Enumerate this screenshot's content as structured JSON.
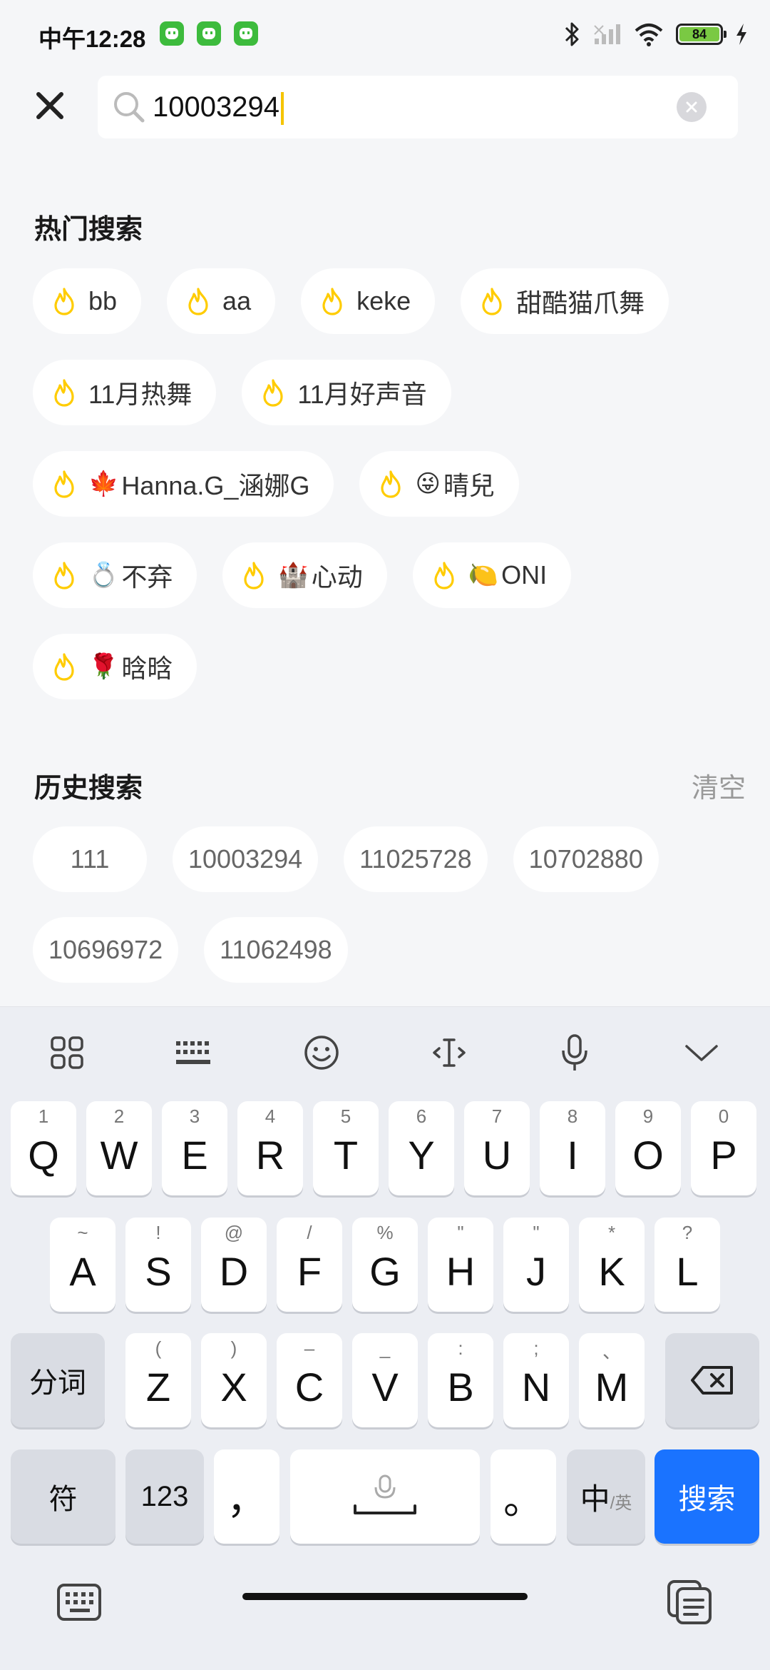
{
  "status_bar": {
    "time": "中午12:28",
    "app_icons": [
      "app-notification-icon",
      "app-notification-icon",
      "app-notification-icon"
    ],
    "battery_level": "84"
  },
  "search": {
    "query": "10003294"
  },
  "hot": {
    "title": "热门搜索",
    "items": [
      {
        "emoji": "",
        "label": "bb"
      },
      {
        "emoji": "",
        "label": "aa"
      },
      {
        "emoji": "",
        "label": "keke"
      },
      {
        "emoji": "",
        "label": "甜酷猫爪舞"
      },
      {
        "emoji": "",
        "label": "11月热舞"
      },
      {
        "emoji": "",
        "label": "11月好声音"
      },
      {
        "emoji": "🍁",
        "label": "Hanna.G_涵娜G"
      },
      {
        "emoji": "😜",
        "label": " 晴兒"
      },
      {
        "emoji": "💍",
        "label": "不弃"
      },
      {
        "emoji": "🏰",
        "label": "心动"
      },
      {
        "emoji": "🍋",
        "label": "ONI"
      },
      {
        "emoji": "🌹",
        "label": "晗晗"
      }
    ]
  },
  "history": {
    "title": "历史搜索",
    "clear_label": "清空",
    "items": [
      "111",
      "10003294",
      "11025728",
      "10702880",
      "10696972",
      "11062498"
    ]
  },
  "keyboard": {
    "toolbar_icons": [
      "apps-grid-icon",
      "keyboard-layout-icon",
      "emoji-icon",
      "cursor-icon",
      "microphone-icon",
      "collapse-icon"
    ],
    "row1": [
      {
        "k": "Q",
        "h": "1"
      },
      {
        "k": "W",
        "h": "2"
      },
      {
        "k": "E",
        "h": "3"
      },
      {
        "k": "R",
        "h": "4"
      },
      {
        "k": "T",
        "h": "5"
      },
      {
        "k": "Y",
        "h": "6"
      },
      {
        "k": "U",
        "h": "7"
      },
      {
        "k": "I",
        "h": "8"
      },
      {
        "k": "O",
        "h": "9"
      },
      {
        "k": "P",
        "h": "0"
      }
    ],
    "row2": [
      {
        "k": "A",
        "h": "~"
      },
      {
        "k": "S",
        "h": "!"
      },
      {
        "k": "D",
        "h": "@"
      },
      {
        "k": "F",
        "h": "/"
      },
      {
        "k": "G",
        "h": "%"
      },
      {
        "k": "H",
        "h": "\""
      },
      {
        "k": "J",
        "h": "\""
      },
      {
        "k": "K",
        "h": "*"
      },
      {
        "k": "L",
        "h": "?"
      }
    ],
    "row3": [
      {
        "k": "Z",
        "h": "("
      },
      {
        "k": "X",
        "h": ")"
      },
      {
        "k": "C",
        "h": "–"
      },
      {
        "k": "V",
        "h": "_"
      },
      {
        "k": "B",
        "h": ":"
      },
      {
        "k": "N",
        "h": ";"
      },
      {
        "k": "M",
        "h": "、"
      }
    ],
    "segment_label": "分词",
    "symbol_label": "符",
    "number_label": "123",
    "comma_label": "，",
    "period_label": "。",
    "lang_main": "中",
    "lang_sub": "/英",
    "search_label": "搜索"
  }
}
